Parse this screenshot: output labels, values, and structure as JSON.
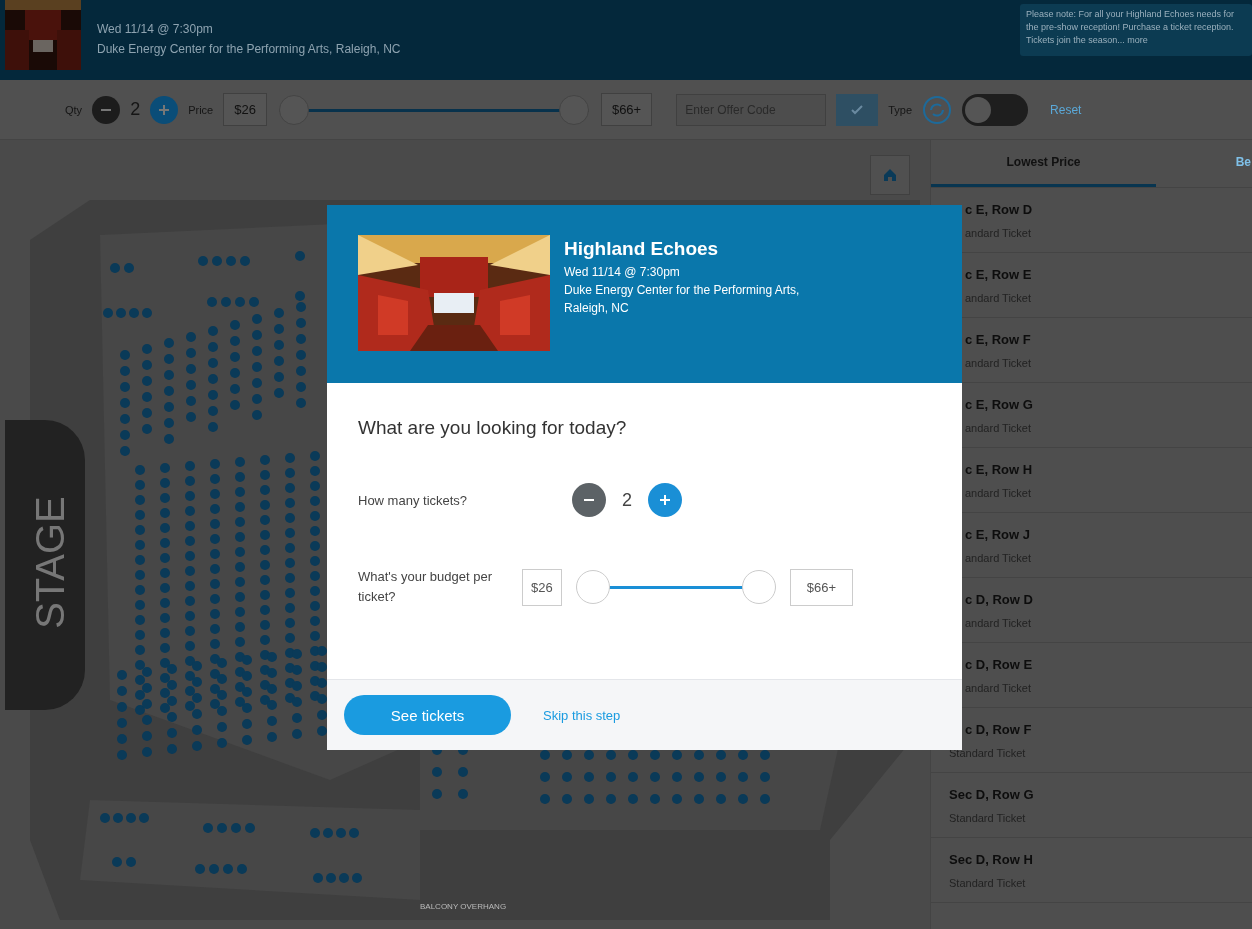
{
  "event_header": {
    "date": "Wed 11/14 @ 7:30pm",
    "venue": "Duke Energy Center for the Performing Arts, Raleigh, NC",
    "notice": "Please note: For all your Highland Echoes needs for the pre-show reception! Purchase a ticket reception. Tickets join the season... more"
  },
  "filters": {
    "qty_label": "Qty",
    "qty": "2",
    "price_label": "Price",
    "min_price": "$26",
    "max_price": "$66+",
    "thumbs": [
      {
        "level": 0
      },
      {
        "level": 1
      }
    ],
    "offer_code": {
      "placeholder": "Enter Offer Code"
    },
    "type_label": "Type",
    "toggle": {
      "on": false
    },
    "reset": "Reset"
  },
  "map": {
    "stage": "STAGE",
    "overhang": "BALCONY OVERHANG"
  },
  "sort_tabs": [
    {
      "label": "Lowest Price",
      "selected": true
    },
    {
      "label": "Be",
      "selected": false
    }
  ],
  "listings": [
    {
      "kind": "covered",
      "section": "c E, Row D",
      "ticket_type": "andard Ticket"
    },
    {
      "kind": "covered",
      "section": "c E, Row E",
      "ticket_type": "andard Ticket"
    },
    {
      "kind": "covered",
      "section": "c E, Row F",
      "ticket_type": "andard Ticket"
    },
    {
      "kind": "covered",
      "section": "c E, Row G",
      "ticket_type": "andard Ticket"
    },
    {
      "kind": "covered",
      "section": "c E, Row H",
      "ticket_type": "andard Ticket"
    },
    {
      "kind": "covered",
      "section": "c E, Row J",
      "ticket_type": "andard Ticket"
    },
    {
      "kind": "covered",
      "section": "c D, Row D",
      "ticket_type": "andard Ticket"
    },
    {
      "kind": "covered",
      "section": "c D, Row E",
      "ticket_type": "andard Ticket"
    },
    {
      "kind": "half",
      "section": "c D, Row F",
      "ticket_type": "Standard Ticket"
    },
    {
      "kind": "full",
      "section": "Sec D, Row G",
      "ticket_type": "Standard Ticket"
    },
    {
      "kind": "full",
      "section": "Sec D, Row H",
      "ticket_type": "Standard Ticket"
    }
  ],
  "modal": {
    "title": "Highland Echoes",
    "date": "Wed 11/14 @ 7:30pm",
    "venue": "Duke Energy Center for the Performing Arts,",
    "city": "Raleigh, NC",
    "question": "What are you looking for today?",
    "tickets_label": "How many tickets?",
    "tickets": "2",
    "budget_label": "What's your budget per ticket?",
    "min_price": "$26",
    "max_price": "$66+",
    "thumbs": [
      {
        "level": 0
      },
      {
        "level": 1
      }
    ],
    "primary_button": "See tickets",
    "skip_link": "Skip this step"
  }
}
